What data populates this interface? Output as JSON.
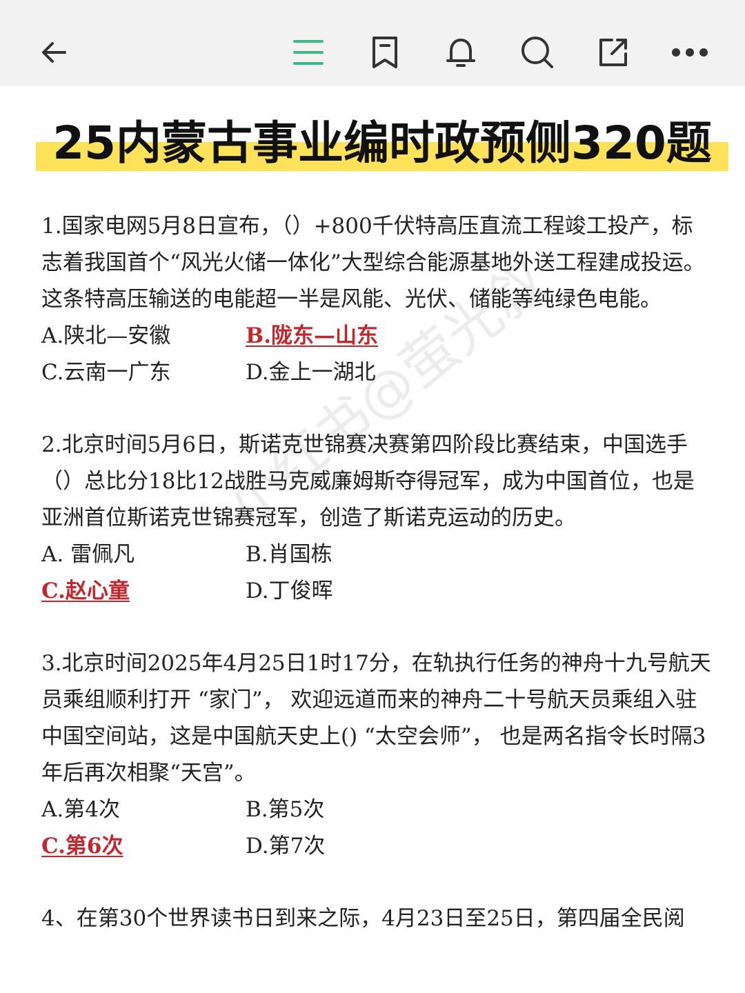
{
  "toolbar": {
    "icons": [
      "back-arrow-icon",
      "menu-icon",
      "bookmark-icon",
      "bell-icon",
      "search-icon",
      "share-icon",
      "more-icon"
    ]
  },
  "title": "25内蒙古事业编时政预侧320题",
  "colors": {
    "toolbar_bg": "#f2f2f2",
    "highlight": "#fde25a",
    "correct": "#c0282e",
    "menu_icon": "#3cb88a"
  },
  "questions": [
    {
      "text": "1.国家电网5月8日宣布，（）+800千伏特高压直流工程竣工投产，标志着我国首个“风光火储一体化”大型综合能源基地外送工程建成投运。这条特高压输送的电能超一半是风能、光伏、储能等纯绿色电能。",
      "options": [
        "A.陕北—安徽",
        "B.陇东—山东",
        "C.云南一广东",
        "D.金上一湖北"
      ],
      "correct": 1
    },
    {
      "text": "2.北京时间5月6日，斯诺克世锦赛决赛第四阶段比赛结束，中国选手（）总比分18比12战胜马克威廉姆斯夺得冠军，成为中国首位，也是亚洲首位斯诺克世锦赛冠军，创造了斯诺克运动的历史。",
      "options": [
        "A. 雷佩凡",
        "B.肖国栋",
        "C.赵心童",
        "D.丁俊晖"
      ],
      "correct": 2
    },
    {
      "text": "3.北京时间2025年4月25日1时17分，在轨执行任务的神舟十九号航天员乘组顺利打开 “家门”， 欢迎远道而来的神舟二十号航天员乘组入驻中国空间站，这是中国航天史上() “太空会师”， 也是两名指令长时隔3年后再次相聚“天宫”。",
      "options": [
        "A.第4次",
        "B.第5次",
        "C.第6次",
        "D.第7次"
      ],
      "correct": 2
    },
    {
      "text": "4、在第30个世界读书日到来之际，4月23日至25日，第四届全民阅",
      "options": [],
      "correct": -1
    }
  ],
  "watermark": "小红书@萤光叙"
}
